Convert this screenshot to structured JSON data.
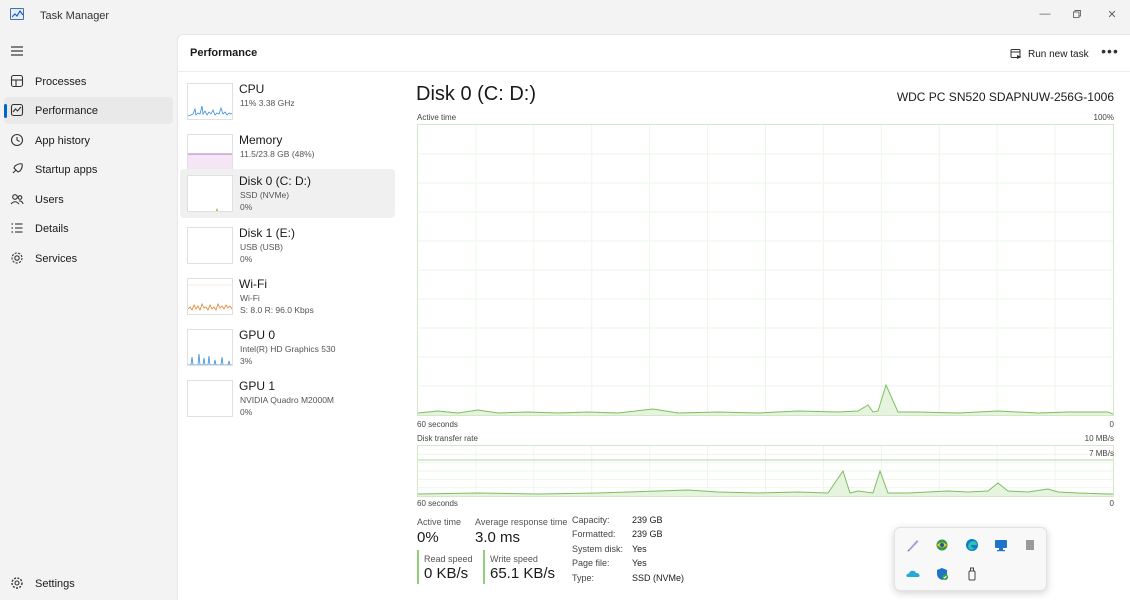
{
  "window": {
    "title": "Task Manager"
  },
  "nav": {
    "items": [
      {
        "label": "Processes",
        "icon": "processes-icon"
      },
      {
        "label": "Performance",
        "icon": "performance-icon",
        "active": true
      },
      {
        "label": "App history",
        "icon": "app-history-icon"
      },
      {
        "label": "Startup apps",
        "icon": "startup-apps-icon"
      },
      {
        "label": "Users",
        "icon": "users-icon"
      },
      {
        "label": "Details",
        "icon": "details-icon"
      },
      {
        "label": "Services",
        "icon": "services-icon"
      }
    ],
    "settings": "Settings"
  },
  "header": {
    "title": "Performance",
    "run_new_task": "Run new task",
    "more": "•••"
  },
  "devices": [
    {
      "name": "CPU",
      "sub1": "11%  3.38 GHz",
      "sub2": ""
    },
    {
      "name": "Memory",
      "sub1": "11.5/23.8 GB (48%)",
      "sub2": ""
    },
    {
      "name": "Disk 0 (C: D:)",
      "sub1": "SSD (NVMe)",
      "sub2": "0%"
    },
    {
      "name": "Disk 1 (E:)",
      "sub1": "USB (USB)",
      "sub2": "0%"
    },
    {
      "name": "Wi-Fi",
      "sub1": "Wi-Fi",
      "sub2": "S: 8.0  R: 96.0 Kbps"
    },
    {
      "name": "GPU 0",
      "sub1": "Intel(R) HD Graphics 530",
      "sub2": "3%"
    },
    {
      "name": "GPU 1",
      "sub1": "NVIDIA Quadro M2000M",
      "sub2": "0%"
    }
  ],
  "detail": {
    "title": "Disk 0 (C: D:)",
    "model": "WDC PC SN520 SDAPNUW-256G-1006",
    "active_time": {
      "label": "Active time",
      "max": "100%",
      "time_left": "60 seconds",
      "min": "0"
    },
    "transfer_rate": {
      "label": "Disk transfer rate",
      "max": "10 MB/s",
      "mid": "7 MB/s",
      "time_left": "60 seconds",
      "min": "0"
    },
    "stats": {
      "active_time_label": "Active time",
      "active_time_value": "0%",
      "response_label": "Average response time",
      "response_value": "3.0 ms",
      "read_label": "Read speed",
      "read_value": "0 KB/s",
      "write_label": "Write speed",
      "write_value": "65.1 KB/s"
    },
    "properties": [
      {
        "key": "Capacity:",
        "value": "239 GB"
      },
      {
        "key": "Formatted:",
        "value": "239 GB"
      },
      {
        "key": "System disk:",
        "value": "Yes"
      },
      {
        "key": "Page file:",
        "value": "Yes"
      },
      {
        "key": "Type:",
        "value": "SSD (NVMe)"
      }
    ]
  },
  "colors": {
    "accent": "#0067c0",
    "disk_line": "#7bbf5f",
    "disk_fill": "#e6f3de",
    "cpu": "#3b8ed6",
    "memory": "#a24fa6",
    "wifi": "#d9822b"
  },
  "tray_icons": [
    "pen-icon",
    "globe-app-icon",
    "edge-icon",
    "display-icon",
    "usb-drive-icon",
    "onedrive-icon",
    "defender-icon",
    "safely-remove-icon"
  ]
}
